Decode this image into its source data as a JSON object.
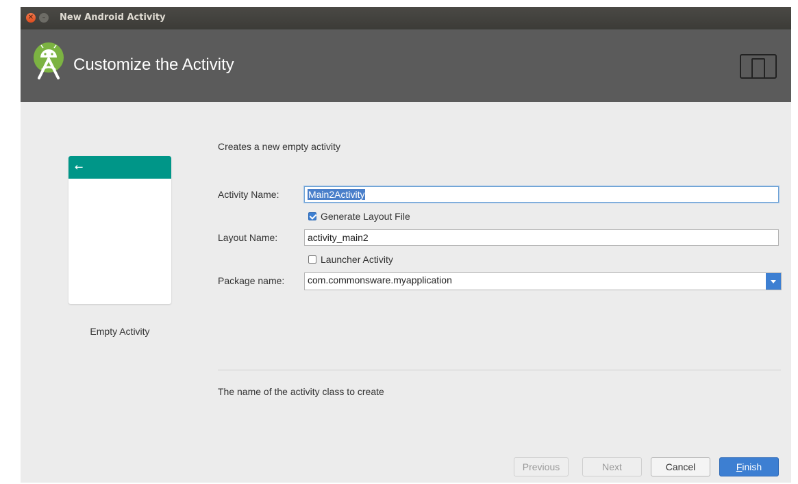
{
  "window": {
    "title": "New Android Activity"
  },
  "header": {
    "title": "Customize the Activity"
  },
  "preview": {
    "back_arrow": "←",
    "label": "Empty Activity"
  },
  "form": {
    "description": "Creates a new empty activity",
    "activity_name_label": "Activity Name:",
    "activity_name_value": "Main2Activity",
    "generate_layout_label": "Generate Layout File",
    "generate_layout_checked": true,
    "layout_name_label": "Layout Name:",
    "layout_name_value": "activity_main2",
    "launcher_activity_label": "Launcher Activity",
    "launcher_activity_checked": false,
    "package_name_label": "Package name:",
    "package_name_value": "com.commonsware.myapplication",
    "hint": "The name of the activity class to create"
  },
  "buttons": {
    "previous": "Previous",
    "next": "Next",
    "cancel": "Cancel",
    "finish_mnemonic": "F",
    "finish_rest": "inish"
  },
  "colors": {
    "header_bg": "#5b5b5b",
    "preview_bar": "#009688",
    "accent_blue": "#3d7fd2",
    "android_green": "#7cb342"
  }
}
